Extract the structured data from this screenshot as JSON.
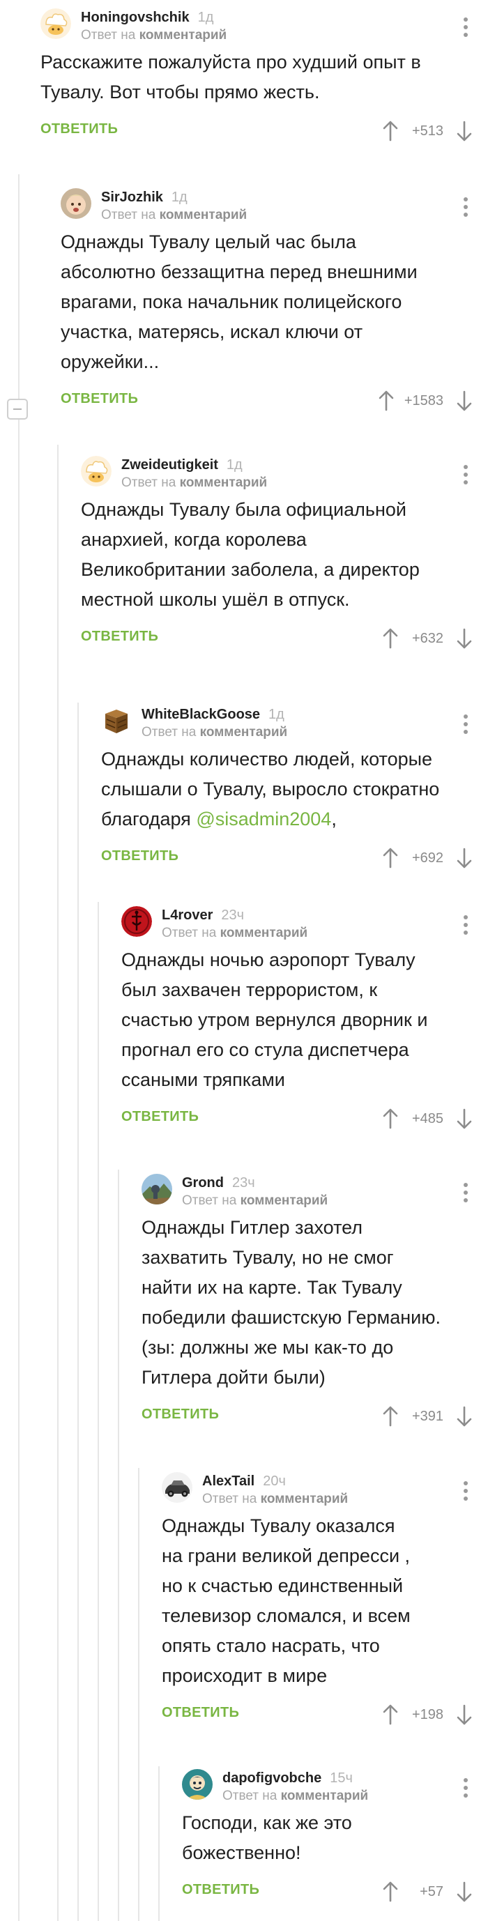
{
  "thread": {
    "comments": [
      {
        "username": "Honingovshchik",
        "time": "1д",
        "reply_prefix": "Ответ на",
        "reply_target": "комментарий",
        "text": "Расскажите пожалуйста про худший опыт в Тувалу. Вот чтобы прямо жесть.",
        "reply_label": "ОТВЕТИТЬ",
        "rating": "+513",
        "avatar": "chef-avatar"
      },
      {
        "username": "SirJozhik",
        "time": "1д",
        "reply_prefix": "Ответ на",
        "reply_target": "комментарий",
        "text": "Однажды Тувалу целый час была абсолютно беззащитна перед внешними врагами, пока начальник полицейского участка, матерясь, искал ключи от оружейки...",
        "reply_label": "ОТВЕТИТЬ",
        "rating": "+1583",
        "avatar": "baby-photo-avatar"
      },
      {
        "username": "Zweideutigkeit",
        "time": "1д",
        "reply_prefix": "Ответ на",
        "reply_target": "комментарий",
        "text": "Однажды Тувалу была официальной анархией, когда королева Великобритании заболела, а директор местной школы ушёл в отпуск.",
        "reply_label": "ОТВЕТИТЬ",
        "rating": "+632",
        "avatar": "chef-avatar"
      },
      {
        "username": "WhiteBlackGoose",
        "time": "1д",
        "reply_prefix": "Ответ на",
        "reply_target": "комментарий",
        "text_before": "Однажды количество людей, которые слышали о Тувалу, выросло стократно благодаря ",
        "mention": "@sisadmin2004",
        "text_after": ",",
        "reply_label": "ОТВЕТИТЬ",
        "rating": "+692",
        "avatar": "crate-avatar"
      },
      {
        "username": "L4rover",
        "time": "23ч",
        "reply_prefix": "Ответ на",
        "reply_target": "комментарий",
        "text": "Однажды ночью аэропорт Тувалу был захвачен террористом, к счастью утром вернулся дворник и прогнал его со стула диспетчера ссаными тряпками",
        "reply_label": "ОТВЕТИТЬ",
        "rating": "+485",
        "avatar": "red-emblem-avatar"
      },
      {
        "username": "Grond",
        "time": "23ч",
        "reply_prefix": "Ответ на",
        "reply_target": "комментарий",
        "text": "Однажды Гитлер захотел захватить Тувалу, но не смог найти их на карте. Так Тувалу победили фашистскую Германию. (зы: должны же мы как-то до Гитлера дойти были)",
        "reply_label": "ОТВЕТИТЬ",
        "rating": "+391",
        "avatar": "landscape-avatar"
      },
      {
        "username": "AlexTail",
        "time": "20ч",
        "reply_prefix": "Ответ на",
        "reply_target": "комментарий",
        "text": "Однажды Тувалу оказался\nна грани великой депресси ,\n но к счастью единственный\nтелевизор сломался, и всем\nопять стало насрать, что\nпроисходит в мире",
        "reply_label": "ОТВЕТИТЬ",
        "rating": "+198",
        "avatar": "car-avatar"
      },
      {
        "username": "dapofigvobche",
        "time": "15ч",
        "reply_prefix": "Ответ на",
        "reply_target": "комментарий",
        "text": "Господи, как же это божественно!",
        "reply_label": "ОТВЕТИТЬ",
        "rating": "+57",
        "avatar": "cartoon-avatar"
      }
    ]
  },
  "colors": {
    "accent_green": "#79b642",
    "thread_line": "#e6e6e6",
    "muted_text": "#a8a8a8",
    "body_text": "#1f1f1f"
  }
}
